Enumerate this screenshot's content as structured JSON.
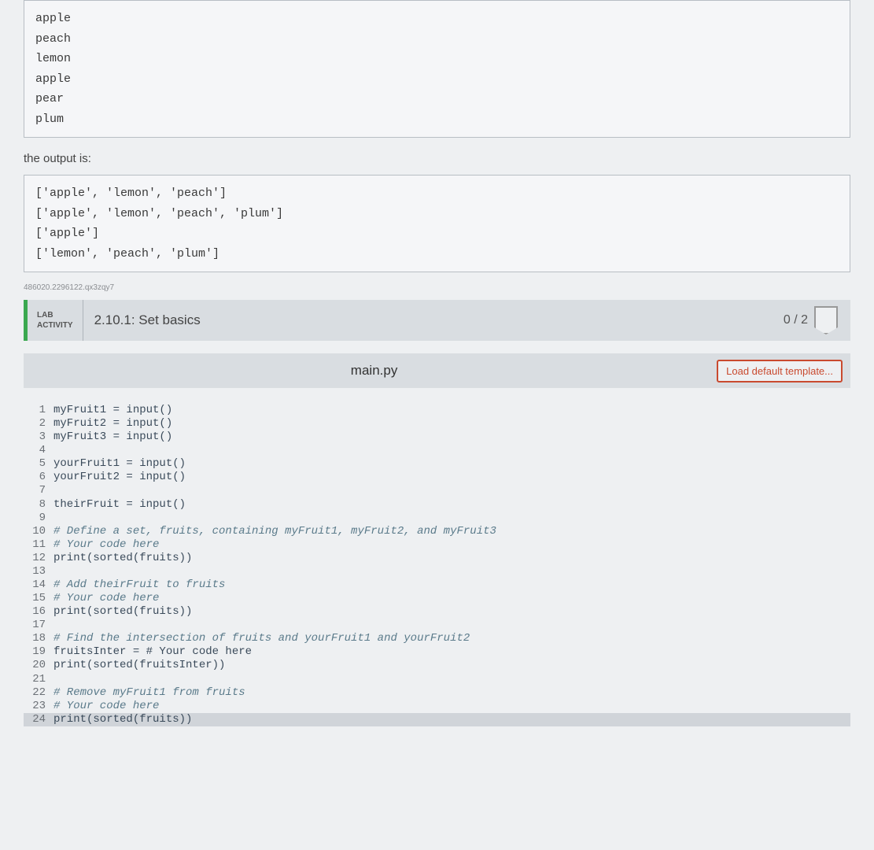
{
  "input_box": {
    "lines": [
      "apple",
      "peach",
      "lemon",
      "apple",
      "pear",
      "plum"
    ]
  },
  "output_label": "the output is:",
  "output_box": {
    "lines": [
      "['apple', 'lemon', 'peach']",
      "['apple', 'lemon', 'peach', 'plum']",
      "['apple']",
      "['lemon', 'peach', 'plum']"
    ]
  },
  "small_id": "486020.2296122.qx3zqy7",
  "lab": {
    "activity_label_line1": "LAB",
    "activity_label_line2": "ACTIVITY",
    "title": "2.10.1: Set basics",
    "score": "0 / 2"
  },
  "editor": {
    "filename": "main.py",
    "load_template_label": "Load default template...",
    "code": [
      {
        "n": 1,
        "text": "myFruit1 = input()",
        "comment": false
      },
      {
        "n": 2,
        "text": "myFruit2 = input()",
        "comment": false
      },
      {
        "n": 3,
        "text": "myFruit3 = input()",
        "comment": false
      },
      {
        "n": 4,
        "text": "",
        "comment": false
      },
      {
        "n": 5,
        "text": "yourFruit1 = input()",
        "comment": false
      },
      {
        "n": 6,
        "text": "yourFruit2 = input()",
        "comment": false
      },
      {
        "n": 7,
        "text": "",
        "comment": false
      },
      {
        "n": 8,
        "text": "theirFruit = input()",
        "comment": false
      },
      {
        "n": 9,
        "text": "",
        "comment": false
      },
      {
        "n": 10,
        "text": "# Define a set, fruits, containing myFruit1, myFruit2, and myFruit3",
        "comment": true
      },
      {
        "n": 11,
        "text": "# Your code here",
        "comment": true
      },
      {
        "n": 12,
        "text": "print(sorted(fruits))",
        "comment": false
      },
      {
        "n": 13,
        "text": "",
        "comment": false
      },
      {
        "n": 14,
        "text": "# Add theirFruit to fruits",
        "comment": true
      },
      {
        "n": 15,
        "text": "# Your code here",
        "comment": true
      },
      {
        "n": 16,
        "text": "print(sorted(fruits))",
        "comment": false
      },
      {
        "n": 17,
        "text": "",
        "comment": false
      },
      {
        "n": 18,
        "text": "# Find the intersection of fruits and yourFruit1 and yourFruit2",
        "comment": true
      },
      {
        "n": 19,
        "text": "fruitsInter = # Your code here",
        "comment": false
      },
      {
        "n": 20,
        "text": "print(sorted(fruitsInter))",
        "comment": false
      },
      {
        "n": 21,
        "text": "",
        "comment": false
      },
      {
        "n": 22,
        "text": "# Remove myFruit1 from fruits",
        "comment": true
      },
      {
        "n": 23,
        "text": "# Your code here",
        "comment": true
      },
      {
        "n": 24,
        "text": "print(sorted(fruits))",
        "comment": false,
        "current": true
      }
    ]
  }
}
